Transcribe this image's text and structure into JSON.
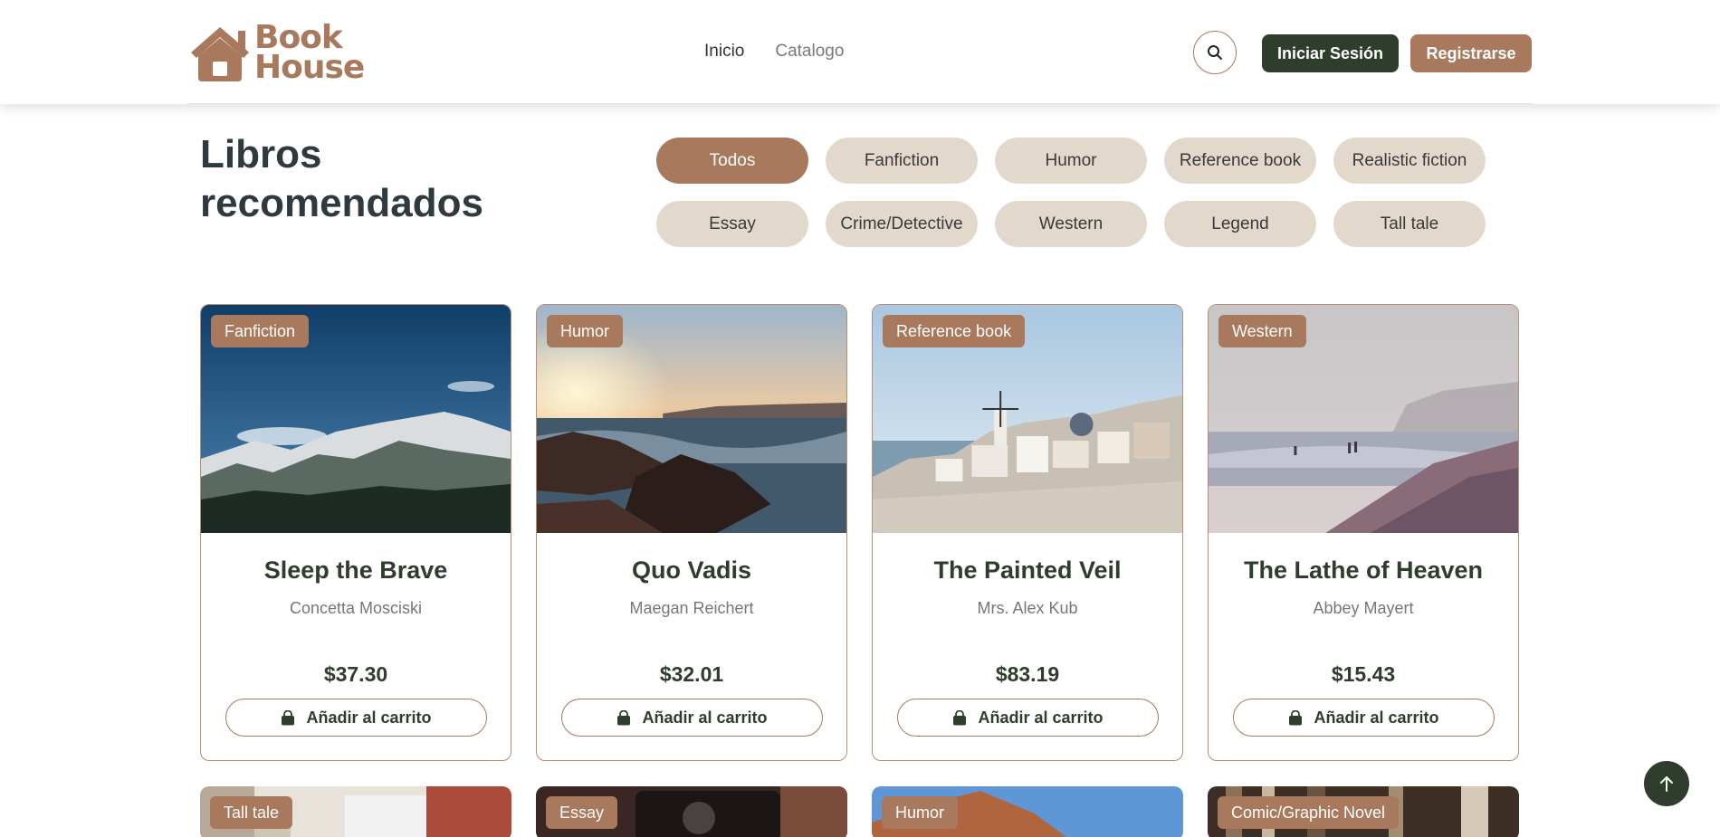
{
  "brand": {
    "line1": "Book",
    "line2": "House",
    "color": "#a8795d"
  },
  "nav": {
    "items": [
      {
        "label": "Inicio"
      },
      {
        "label": "Catalogo"
      }
    ]
  },
  "header": {
    "login_label": "Iniciar Sesión",
    "register_label": "Registrarse"
  },
  "section": {
    "title": "Libros recomendados"
  },
  "filters": [
    "Todos",
    "Fanfiction",
    "Humor",
    "Reference book",
    "Realistic fiction",
    "Essay",
    "Crime/Detective",
    "Western",
    "Legend",
    "Tall tale"
  ],
  "cards": [
    {
      "category": "Fanfiction",
      "title": "Sleep the Brave",
      "author": "Concetta Mosciski",
      "price": "$37.30",
      "cart_label": "Añadir al carrito",
      "image": "snowy-mountains"
    },
    {
      "category": "Humor",
      "title": "Quo Vadis",
      "author": "Maegan Reichert",
      "price": "$32.01",
      "cart_label": "Añadir al carrito",
      "image": "sunset-sea-rocks"
    },
    {
      "category": "Reference book",
      "title": "The Painted Veil",
      "author": "Mrs. Alex Kub",
      "price": "$83.19",
      "cart_label": "Añadir al carrito",
      "image": "white-village"
    },
    {
      "category": "Western",
      "title": "The Lathe of Heaven",
      "author": "Abbey Mayert",
      "price": "$15.43",
      "cart_label": "Añadir al carrito",
      "image": "misty-beach"
    }
  ],
  "cards_row2": [
    {
      "category": "Tall tale",
      "image": "city-street"
    },
    {
      "category": "Essay",
      "image": "camera"
    },
    {
      "category": "Humor",
      "image": "desert-sky"
    },
    {
      "category": "Comic/Graphic Novel",
      "image": "bookshelf"
    }
  ],
  "colors": {
    "accent": "#a8795d",
    "dark_green": "#2f3d2c",
    "chip_bg": "#e2d9cc"
  }
}
